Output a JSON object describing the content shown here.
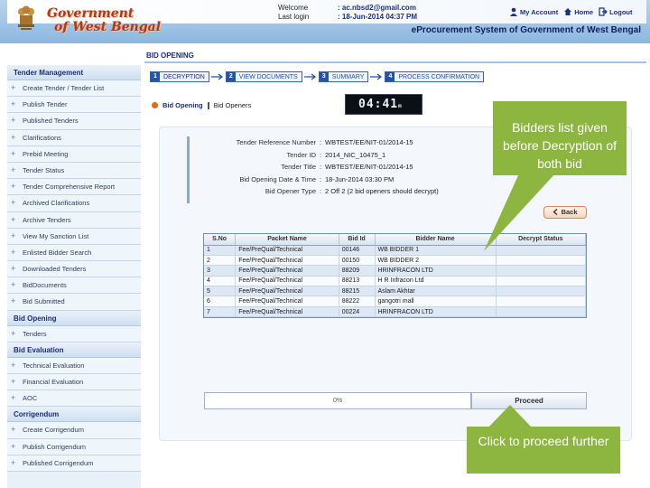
{
  "header": {
    "logo_line1": "Government",
    "logo_line2": "of West Bengal",
    "welcome_label": "Welcome",
    "welcome_value": ": ac.nbsd2@gmail.com",
    "lastlogin_label": "Last login",
    "lastlogin_value": ": 18-Jun-2014 04:37 PM",
    "links": {
      "account": "My Account",
      "home": "Home",
      "logout": "Logout"
    },
    "system_title": "eProcurement System of Government of West Bengal"
  },
  "sidebar": {
    "sections": [
      {
        "title": "Tender Management",
        "items": [
          "Create Tender / Tender List",
          "Publish Tender",
          "Published Tenders",
          "Clarifications",
          "Prebid Meeting",
          "Tender Status",
          "Tender Comprehensive Report",
          "Archived Clarifications",
          "Archive Tenders",
          "View My Sanction List",
          "Enlisted Bidder Search",
          "Downloaded Tenders",
          "BidDocuments",
          "Bid Submitted"
        ]
      },
      {
        "title": "Bid Opening",
        "items": [
          "Tenders"
        ]
      },
      {
        "title": "Bid Evaluation",
        "items": [
          "Technical Evaluation",
          "Financial Evaluation",
          "AOC"
        ]
      },
      {
        "title": "Corrigendum",
        "items": [
          "Create Corrigendum",
          "Publish Corrigendum",
          "Published Corrigendum"
        ]
      }
    ]
  },
  "main": {
    "title": "BID OPENING",
    "steps": [
      {
        "num": "1",
        "label": "DECRYPTION"
      },
      {
        "num": "2",
        "label": "VIEW DOCUMENTS"
      },
      {
        "num": "3",
        "label": "SUMMARY"
      },
      {
        "num": "4",
        "label": "PROCESS CONFIRMATION"
      }
    ],
    "breadcrumb_current": "Bid Opening",
    "breadcrumb_next": "Bid Openers",
    "timer": "04:41",
    "timer_suffix": "m",
    "info": [
      {
        "label": "Tender Reference Number",
        "value": "WBTEST/EE/NIT-01/2014-15"
      },
      {
        "label": "Tender ID",
        "value": "2014_NIC_10475_1"
      },
      {
        "label": "Tender Title",
        "value": "WBTEST/EE/NIT-01/2014-15"
      },
      {
        "label": "Bid Opening Date & Time",
        "value": "18-Jun-2014 03:30 PM"
      },
      {
        "label": "Bid Opener Type",
        "value": "2 Off 2 (2 bid openers should decrypt)"
      }
    ],
    "back_label": "Back",
    "table": {
      "headers": [
        "S.No",
        "Packet Name",
        "Bid Id",
        "Bidder Name",
        "Decrypt Status"
      ],
      "rows": [
        [
          "1",
          "Fee/PreQual/Technical",
          "00146",
          "WB BIDDER 1",
          ""
        ],
        [
          "2",
          "Fee/PreQual/Technical",
          "00150",
          "WB BIDDER 2",
          ""
        ],
        [
          "3",
          "Fee/PreQual/Technical",
          "88209",
          "HRINFRACON LTD",
          ""
        ],
        [
          "4",
          "Fee/PreQual/Technical",
          "88213",
          "H R Infracon Ltd",
          ""
        ],
        [
          "5",
          "Fee/PreQual/Technical",
          "88215",
          "Aslam Akhtar",
          ""
        ],
        [
          "6",
          "Fee/PreQual/Technical",
          "88222",
          "gangotri mall",
          ""
        ],
        [
          "7",
          "Fee/PreQual/Technical",
          "00224",
          "HRINFRACON LTD",
          ""
        ]
      ]
    },
    "progress_text": "0%",
    "progress_value": 0,
    "proceed_label": "Proceed"
  },
  "callouts": {
    "bidders_note": "Bidders list given before Decryption of both bid",
    "proceed_note": "Click to proceed further"
  },
  "colors": {
    "callout": "#8db640",
    "accent": "#2454a4",
    "logo": "#b5341c"
  },
  "icons": [
    "emblem-icon",
    "user-icon",
    "home-icon",
    "logout-icon",
    "plus-icon",
    "arrow-icon",
    "back-arrow-icon"
  ]
}
